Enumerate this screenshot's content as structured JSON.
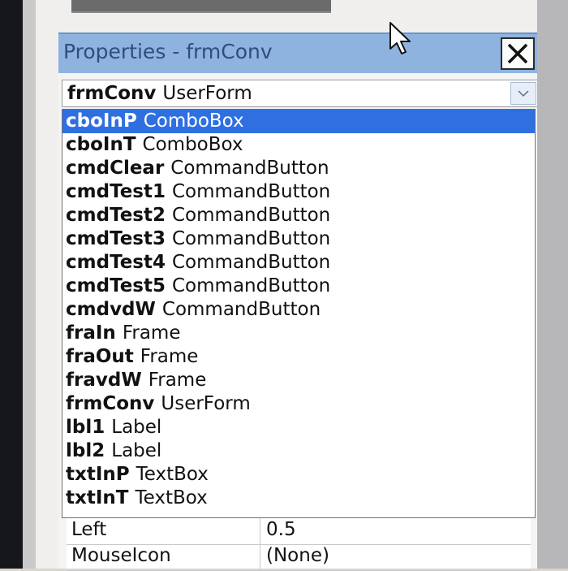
{
  "window": {
    "title": "Properties - frmConv"
  },
  "object_selector": {
    "selected_object": "frmConv",
    "selected_type": "UserForm"
  },
  "dropdown": {
    "items": [
      {
        "name": "cboInP",
        "type": "ComboBox",
        "selected": true
      },
      {
        "name": "cboInT",
        "type": "ComboBox"
      },
      {
        "name": "cmdClear",
        "type": "CommandButton"
      },
      {
        "name": "cmdTest1",
        "type": "CommandButton"
      },
      {
        "name": "cmdTest2",
        "type": "CommandButton"
      },
      {
        "name": "cmdTest3",
        "type": "CommandButton"
      },
      {
        "name": "cmdTest4",
        "type": "CommandButton"
      },
      {
        "name": "cmdTest5",
        "type": "CommandButton"
      },
      {
        "name": "cmdvdW",
        "type": "CommandButton"
      },
      {
        "name": "fraIn",
        "type": "Frame"
      },
      {
        "name": "fraOut",
        "type": "Frame"
      },
      {
        "name": "fravdW",
        "type": "Frame"
      },
      {
        "name": "frmConv",
        "type": "UserForm"
      },
      {
        "name": "lbl1",
        "type": "Label"
      },
      {
        "name": "lbl2",
        "type": "Label"
      },
      {
        "name": "txtInP",
        "type": "TextBox"
      },
      {
        "name": "txtInT",
        "type": "TextBox"
      }
    ]
  },
  "properties": [
    {
      "name": "Left",
      "value": "0.5"
    },
    {
      "name": "MouseIcon",
      "value": "(None)"
    }
  ],
  "icons": {
    "close": "close-icon",
    "dropdown": "chevron-down-icon",
    "cursor": "mouse-pointer-icon"
  },
  "colors": {
    "titlebar": "#8fb3df",
    "selection": "#2f6fdf"
  }
}
